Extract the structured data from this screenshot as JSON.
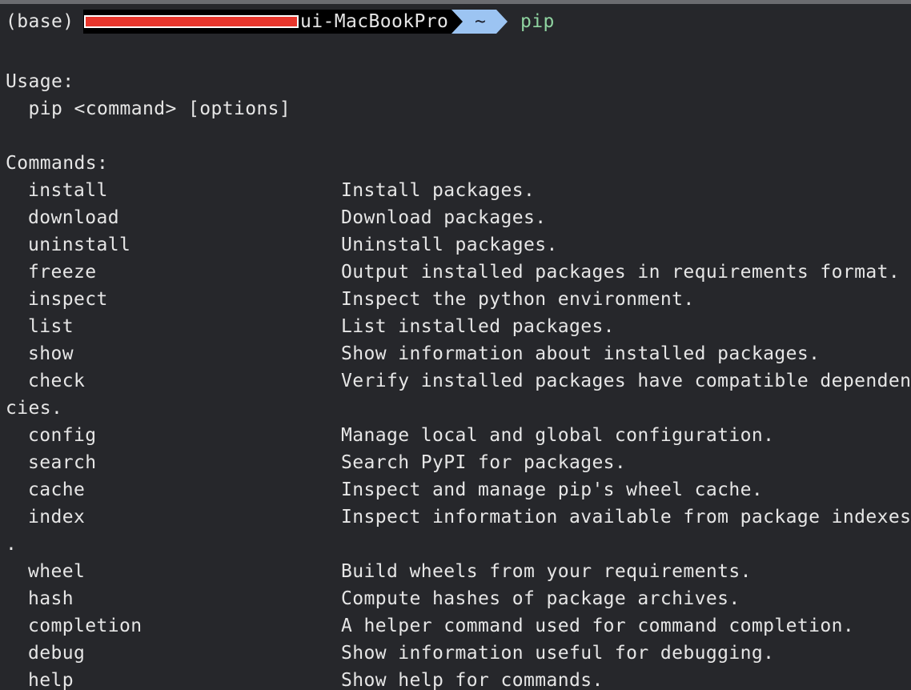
{
  "prompt": {
    "env": "(base)",
    "host_suffix": "ui-MacBookPro",
    "directory": "~",
    "command": "pip"
  },
  "usage": {
    "heading": "Usage:",
    "syntax": "  pip <command> [options]"
  },
  "commands_heading": "Commands:",
  "commands": [
    {
      "name": "install",
      "desc": "Install packages."
    },
    {
      "name": "download",
      "desc": "Download packages."
    },
    {
      "name": "uninstall",
      "desc": "Uninstall packages."
    },
    {
      "name": "freeze",
      "desc": "Output installed packages in requirements format."
    },
    {
      "name": "inspect",
      "desc": "Inspect the python environment."
    },
    {
      "name": "list",
      "desc": "List installed packages."
    },
    {
      "name": "show",
      "desc": "Show information about installed packages."
    },
    {
      "name": "check",
      "desc": "Verify installed packages have compatible dependen"
    },
    {
      "wrap": "cies."
    },
    {
      "name": "config",
      "desc": "Manage local and global configuration."
    },
    {
      "name": "search",
      "desc": "Search PyPI for packages."
    },
    {
      "name": "cache",
      "desc": "Inspect and manage pip's wheel cache."
    },
    {
      "name": "index",
      "desc": "Inspect information available from package indexes"
    },
    {
      "wrap": "."
    },
    {
      "name": "wheel",
      "desc": "Build wheels from your requirements."
    },
    {
      "name": "hash",
      "desc": "Compute hashes of package archives."
    },
    {
      "name": "completion",
      "desc": "A helper command used for command completion."
    },
    {
      "name": "debug",
      "desc": "Show information useful for debugging."
    },
    {
      "name": "help",
      "desc": "Show help for commands."
    }
  ],
  "colors": {
    "background": "#26272b",
    "text": "#e6e6e6",
    "command_text": "#8fd3a0",
    "dir_segment": "#9cc4f2",
    "host_segment": "#000000",
    "redaction": "#e8362c"
  }
}
